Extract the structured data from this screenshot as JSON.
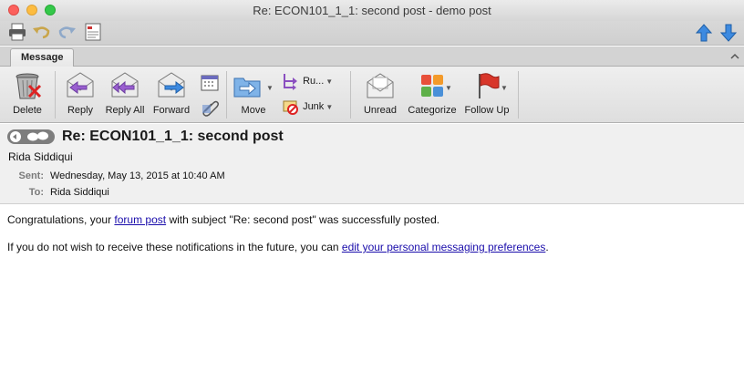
{
  "window": {
    "title": "Re: ECON101_1_1: second post - demo post"
  },
  "ribbon": {
    "tab": "Message",
    "buttons": {
      "delete": "Delete",
      "reply": "Reply",
      "reply_all": "Reply All",
      "forward": "Forward",
      "move": "Move",
      "rules": "Ru...",
      "junk": "Junk",
      "unread": "Unread",
      "categorize": "Categorize",
      "follow_up": "Follow Up"
    }
  },
  "message": {
    "subject": "Re: ECON101_1_1: second post",
    "from": "Rida Siddiqui",
    "sent_label": "Sent:",
    "sent": "Wednesday, May 13, 2015 at 10:40 AM",
    "to_label": "To:",
    "to": "Rida Siddiqui",
    "body": {
      "line1_pre": "Congratulations, your ",
      "line1_link": "forum post",
      "line1_post": " with subject \"Re: second post\" was successfully posted.",
      "line2_pre": "If you do not wish to receive these notifications in the future, you can ",
      "line2_link": "edit your personal messaging preferences",
      "line2_post": "."
    }
  },
  "colors": {
    "link": "#1a0dab",
    "close_light": "#fc605c",
    "minimize_light": "#fdbc40",
    "zoom_light": "#34c84a",
    "nav_arrow": "#2f7fd6"
  }
}
